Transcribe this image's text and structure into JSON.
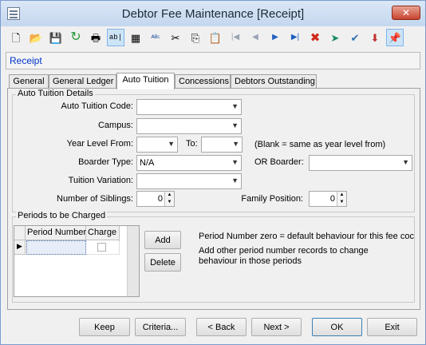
{
  "window": {
    "title": "Debtor Fee Maintenance  [Receipt]",
    "close_label": "✕"
  },
  "toolbar": {
    "icons": [
      "new-document-icon",
      "open-folder-icon",
      "save-icon",
      "refresh-icon",
      "print-icon",
      "field-label-icon",
      "calculator-icon",
      "spellcheck-icon",
      "cut-icon",
      "copy-icon",
      "paste-icon",
      "first-record-icon",
      "previous-record-icon",
      "next-record-icon",
      "last-record-icon",
      "delete-icon",
      "navigate-icon",
      "approve-icon",
      "export-icon",
      "pin-icon"
    ],
    "glyphs": [
      "🗋",
      "📂",
      "💾",
      "↻",
      "🖶",
      "ab|",
      "▦",
      "ᴬᴮᶜ",
      "✂",
      "⎘",
      "📋",
      "|◀",
      "◀",
      "▶",
      "▶|",
      "✖",
      "➤",
      "✔",
      "⬇",
      "📌"
    ],
    "colors": {
      "record_nav": "#1f5fbf",
      "delete": "#d0261a",
      "save": "#7030a0",
      "refresh": "#2d9a3a"
    }
  },
  "header": {
    "text": "Receipt"
  },
  "tabs": [
    {
      "label": "General",
      "active": false
    },
    {
      "label": "General Ledger",
      "active": false
    },
    {
      "label": "Auto Tuition",
      "active": true
    },
    {
      "label": "Concessions",
      "active": false
    },
    {
      "label": "Debtors Outstanding",
      "active": false
    }
  ],
  "auto_tuition": {
    "group_title": "Auto Tuition Details",
    "code_label": "Auto Tuition Code:",
    "code_value": "",
    "campus_label": "Campus:",
    "campus_value": "",
    "year_from_label": "Year Level From:",
    "year_from_value": "",
    "year_to_label": "To:",
    "year_to_value": "",
    "year_note": "(Blank = same as year level from)",
    "boarder_label": "Boarder Type:",
    "boarder_value": "N/A",
    "or_boarder_label": "OR Boarder:",
    "or_boarder_value": "",
    "variation_label": "Tuition Variation:",
    "variation_value": "",
    "siblings_label": "Number of Siblings:",
    "siblings_value": "0",
    "family_label": "Family Position:",
    "family_value": "0"
  },
  "periods": {
    "group_title": "Periods to be Charged",
    "columns": [
      "Period Number",
      "Charge"
    ],
    "rows": [
      {
        "period": "",
        "charge": false
      }
    ],
    "row_indicator": "▶",
    "add_label": "Add",
    "delete_label": "Delete",
    "info_line1": "Period Number zero = default behaviour for this fee coc",
    "info_line2": "Add other period number records to change",
    "info_line3": "behaviour in those periods"
  },
  "footer": {
    "keep": "Keep",
    "criteria": "Criteria...",
    "back": "< Back",
    "next": "Next >",
    "ok": "OK",
    "exit": "Exit"
  }
}
